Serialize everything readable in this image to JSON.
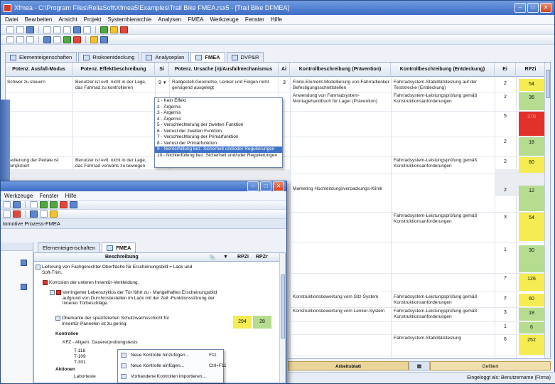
{
  "main_window": {
    "title": "Xfmea - C:\\Program Files\\ReliaSoft\\Xfmea5\\Examples\\Trail Bike FMEA.rsx5 - [Trail Bike DFMEA]",
    "menu": [
      "Datei",
      "Bearbeiten",
      "Ansicht",
      "Projekt",
      "Systemhierarchie",
      "Analysen",
      "FMEA",
      "Werkzeuge",
      "Fenster",
      "Hilfe"
    ],
    "tabs": [
      "Elementeigenschaften",
      "Risikoentdeckung",
      "Analyseplan",
      "FMEA",
      "DVP&R"
    ],
    "columns": [
      "Potenz. Ausfall-Modus",
      "Potenz. Effektbeschreibung",
      "Si",
      "Potenz. Ursache (n)/Ausfallmechanismus",
      "Ai",
      "Kontrollbeschreibung (Prävention)",
      "Kontrollbeschreibung (Entdeckung)",
      "Ei",
      "RPZi"
    ],
    "rows": [
      {
        "mode": "Schwer zu steuern",
        "effect": "Benutzer ist evtl. nicht in der Lage, das Fahrrad zu kontrollieren",
        "si": "9",
        "cause": "Radgestell-Geometrie, Lenker und Felgen nicht genügend ausgelegt",
        "ai": "3",
        "prevention": "Finite-Element-Modellierung von Fahrradlenker Befestigungsschnittstellen",
        "detection": "Fahrradsystem-Stabilitätstestung auf der Teststrecke (Entdeckung)",
        "ei": "2",
        "rpz": "54",
        "color": "yellow"
      },
      {
        "mode": "",
        "effect": "",
        "si": "",
        "cause": "",
        "ai": "",
        "prevention": "Anwendung von Fahrradsystem-Montagehandbuch für Lager (Prävention)",
        "detection": "Fahrradsystem-Leistungsprüfung gemäß Konstruktionsanforderungen",
        "ei": "2",
        "rpz": "36",
        "color": "green"
      },
      {
        "mode": "",
        "effect": "",
        "si": "",
        "cause": "",
        "ai": "",
        "prevention": "",
        "detection": "",
        "ei": "5",
        "rpz": "270",
        "color": "red"
      },
      {
        "mode": "",
        "effect": "",
        "si": "",
        "cause": "",
        "ai": "",
        "prevention": "",
        "detection": "",
        "ei": "2",
        "rpz": "18",
        "color": "green"
      },
      {
        "mode": "Bedienung der Pedale ist kompliziert",
        "effect": "Benutzer ist evtl. nicht in der Lage, das Fahrrad vorwärts zu bewegen",
        "si": "",
        "cause": "",
        "ai": "",
        "prevention": "",
        "detection": "Fahrradsystem-Leistungsprüfung gemäß Konstruktionsanforderungen",
        "ei": "2",
        "rpz": "60",
        "color": "yellow"
      },
      {
        "mode": "",
        "effect": "",
        "si": "",
        "cause": "",
        "ai": "",
        "prevention": "Marketing Hochleistungsverpackungs-Klinik",
        "detection": "",
        "ei": "2",
        "rpz": "12",
        "color": "green"
      },
      {
        "mode": "",
        "effect": "",
        "si": "",
        "cause": "",
        "ai": "",
        "prevention": "",
        "detection": "Fahrradsystem-Leistungsprüfung gemäß Konstruktionsanforderungen",
        "ei": "3",
        "rpz": "54",
        "color": "yellow"
      },
      {
        "mode": "",
        "effect": "",
        "si": "",
        "cause": "",
        "ai": "",
        "prevention": "",
        "detection": "",
        "ei": "1",
        "rpz": "30",
        "color": "green"
      },
      {
        "mode": "",
        "effect": "",
        "si": "",
        "cause": "",
        "ai": "",
        "prevention": "",
        "detection": "",
        "ei": "7",
        "rpz": "126",
        "color": "yellow"
      },
      {
        "mode": "",
        "effect": "",
        "si": "",
        "cause": "",
        "ai": "",
        "prevention": "Konstruktionsbewertung vom Sitz-System",
        "detection": "Fahrradsystem-Leistungsprüfung gemäß Konstruktionsanforderungen",
        "ei": "2",
        "rpz": "60",
        "color": "yellow"
      },
      {
        "mode": "",
        "effect": "",
        "si": "",
        "cause": "",
        "ai": "",
        "prevention": "Konstruktionsbewertung vom Lenker-System",
        "detection": "Fahrradsystem-Leistungsprüfung gemäß Konstruktionsanforderungen",
        "ei": "3",
        "rpz": "18",
        "color": "green"
      },
      {
        "mode": "",
        "effect": "",
        "si": "",
        "cause": "",
        "ai": "",
        "prevention": "",
        "detection": "",
        "ei": "1",
        "rpz": "6",
        "color": "green"
      },
      {
        "mode": "",
        "effect": "",
        "si": "",
        "cause": "",
        "ai": "",
        "prevention": "",
        "detection": "Fahrradsystem-Stabilitätstestung",
        "ei": "6",
        "rpz": "252",
        "color": "yellow"
      }
    ],
    "severity_dropdown": [
      "1 - Kein Effekt",
      "2 - Ärgernis",
      "3 - Ärgernis",
      "4 - Ärgernis",
      "5 - Verschlechterung der zweiten Funktion",
      "6 - Verlust der zweiten Funktion",
      "7 - Verschlechterung der Primärfunktion",
      "8 - Verlust der Primärfunktion",
      "9 - Nichterfüllung bez. Sicherheit und/oder Regulierungen",
      "10 - Nichterfüllung bez. Sicherheit und/oder Regulierungen"
    ],
    "dropdown_selected_index": 8,
    "bottom_tabs": [
      "Arbeitsblatt",
      "Gefiltert"
    ],
    "status": "Eingeloggt als: Benutzername (Firma)"
  },
  "front_window": {
    "menu": [
      "Werkzeuge",
      "Fenster",
      "Hilfe"
    ],
    "project_label": "tomotive Prozess-FMEA",
    "tabs": [
      "Elementeigenschaften",
      "FMEA"
    ],
    "columns": [
      "Beschreibung",
      "RPZi",
      "RPZr"
    ],
    "rows": [
      {
        "text": "Lieferung von Fachgerechter Oberfläche für Erscheinungsbild = Lack und Soft-Trim.",
        "kind": "function"
      },
      {
        "text": "Korrosion der unteren Innentür-Verkleidung.",
        "kind": "failure"
      },
      {
        "text": "Verringerter Lebenszyklus der Tür führt zu - Mangelhaftes Erscheinungsbild aufgrund von Durchrostestellen im Lack mit der Zeit -Funktionsstörung der inneren Türbeschläge.",
        "kind": "effect"
      },
      {
        "text": "Oberkante der spezifizierten Schutzwachsschicht für Innentür-Paneelen ist zu gering.",
        "kind": "cause",
        "rpzi": "294",
        "rpzr": "28"
      },
      {
        "text": "Kontrollen",
        "kind": "group"
      },
      {
        "text": "KFZ - Allgem. Dauererprobungstests",
        "kind": "control"
      },
      {
        "text": "T-118",
        "kind": "sub"
      },
      {
        "text": "T-109",
        "kind": "sub"
      },
      {
        "text": "T-301",
        "kind": "sub"
      },
      {
        "text": "Aktionen",
        "kind": "group"
      },
      {
        "text": "Laborteste",
        "kind": "sub"
      }
    ],
    "context_menu": [
      {
        "label": "Neue Kontrolle hinzufügen...",
        "shortcut": "F11"
      },
      {
        "label": "Neue Kontrolle einfügen...",
        "shortcut": "Ctrl+F11"
      },
      {
        "label": "Vorhandene Kontrollen importieren...",
        "shortcut": ""
      }
    ]
  }
}
